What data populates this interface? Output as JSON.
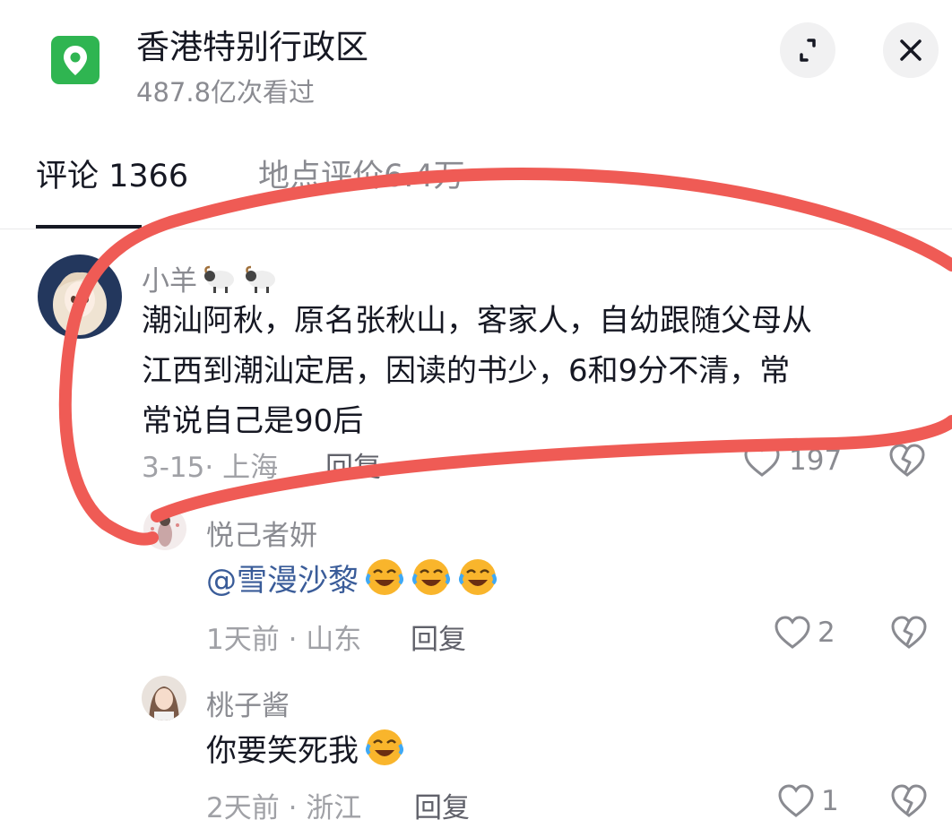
{
  "header": {
    "title": "香港特别行政区",
    "views": "487.8亿次看过",
    "expand_icon": "expand-icon",
    "close_icon": "close-icon",
    "location_icon": "location-pin-icon"
  },
  "tabs": [
    {
      "label": "评论 1366",
      "active": true
    },
    {
      "label": "地点评价6.4万",
      "active": false
    }
  ],
  "comments": [
    {
      "username": "小羊",
      "username_emoji": "sheep-emoji",
      "lines": [
        "潮汕阿秋，原名张秋山，客家人，自幼跟随父母从",
        "江西到潮汕定居，因读的书少，6和9分不清，常",
        "常说自己是90后"
      ],
      "meta": "3-15· 上海",
      "reply_label": "回复",
      "like_count": "197"
    },
    {
      "username": "悦己者妍",
      "mention": "@雪漫沙黎",
      "emoji": "laughing-crying-emoji",
      "meta": "1天前 · 山东",
      "reply_label": "回复",
      "like_count": "2"
    },
    {
      "username": "桃子酱",
      "text": "你要笑死我",
      "emoji": "laughing-crying-emoji",
      "meta": "2天前 · 浙江",
      "reply_label": "回复",
      "like_count": "1"
    }
  ],
  "colors": {
    "accent_green": "#2fb551",
    "annotation_red": "#ef5b55",
    "mention_blue": "#3a5c99"
  }
}
